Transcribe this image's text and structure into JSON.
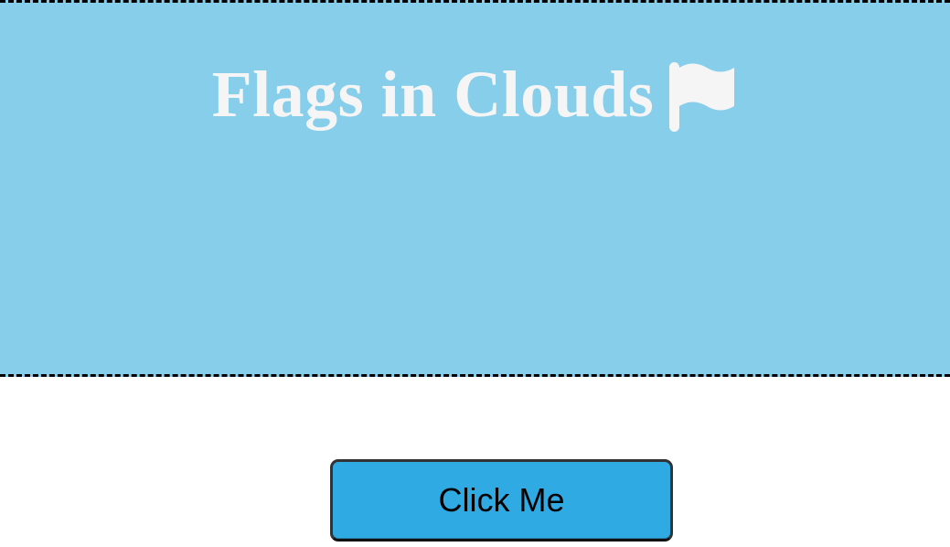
{
  "hero": {
    "title": "Flags in Clouds",
    "icon": "flag-icon",
    "background_color": "#87CEEB",
    "text_color": "#F5F5F5"
  },
  "action": {
    "button_label": "Click Me",
    "button_color": "#2FAAE2"
  }
}
